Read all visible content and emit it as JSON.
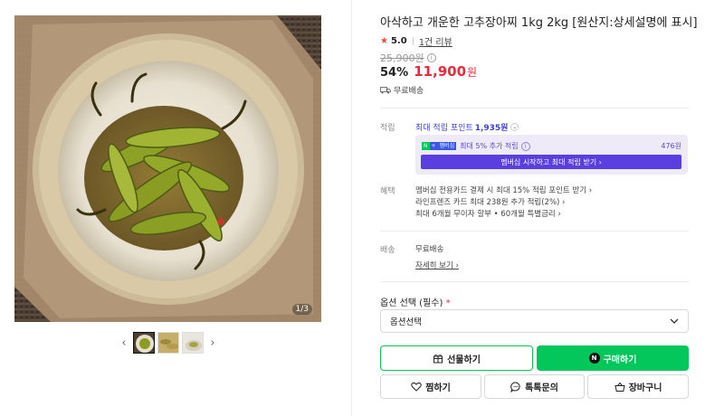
{
  "gallery": {
    "counter": "1/3",
    "thumbnail_count": 3,
    "active_thumbnail": 1
  },
  "product": {
    "title": "아삭하고 개운한 고추장아찌 1kg 2kg [원산지:상세설명에 표시]",
    "rating": "5.0",
    "review_count_label": "1건 리뷰",
    "original_price": "25,900원",
    "discount": "54%",
    "price": "11,900",
    "currency": "원",
    "shipping_summary": "무료배송"
  },
  "points": {
    "label": "적립",
    "headline_prefix": "최대 적립 포인트",
    "headline_amount": "1,935원",
    "membership_badge_n": "N",
    "membership_badge_plus": "+",
    "membership_badge_text": "멤버십",
    "membership_text": "최대 5% 추가 적립",
    "membership_amount": "476원",
    "membership_button": "멤버십 시작하고 최대 적립 받기 ›"
  },
  "benefits": {
    "label": "혜택",
    "lines": [
      "멤버십 전용카드 결제 시 최대 15% 적립 포인트 받기 ›",
      "라인프렌즈 카드 최대 238원 추가 적립(2%) ›",
      "최대 6개월 무이자 할부 • 60개월 특별금리 ›"
    ]
  },
  "delivery": {
    "label": "배송",
    "value": "무료배송",
    "detail_link": "자세히 보기 ›"
  },
  "options": {
    "label": "옵션 선택 (필수)",
    "required_mark": "*",
    "select_value": "옵션선택"
  },
  "actions": {
    "gift": "선물하기",
    "buy": "구매하기",
    "buy_badge": "N",
    "wish": "찜하기",
    "talk": "톡톡문의",
    "cart": "장바구니"
  },
  "colors": {
    "accent_red": "#f0283c",
    "naver_green": "#03c75a",
    "membership_purple": "#5a3ee0",
    "points_blue": "#3e3ed8"
  }
}
